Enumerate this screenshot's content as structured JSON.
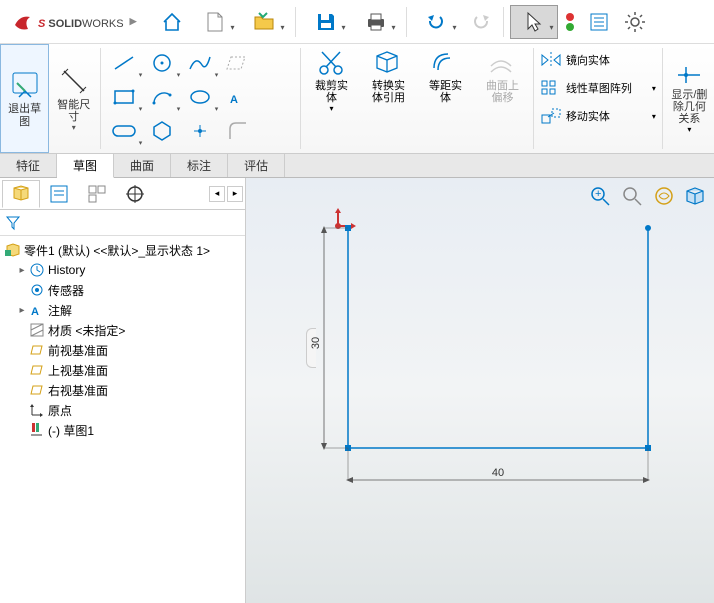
{
  "app_name_1": "SOLID",
  "app_name_2": "WORKS",
  "ribbon": {
    "exit_sketch": "退出草\n图",
    "smart_dim": "智能尺\n寸",
    "trim": "裁剪实\n体",
    "convert": "转换实\n体引用",
    "offset": "等距实\n体",
    "surface_offset": "曲面上\n偏移",
    "mirror": "镜向实体",
    "pattern": "线性草图阵列",
    "move": "移动实体",
    "display": "显示/删\n除几何\n关系"
  },
  "tabs": {
    "features": "特征",
    "sketch": "草图",
    "surfaces": "曲面",
    "annotate": "标注",
    "evaluate": "评估"
  },
  "tree": {
    "root": "零件1 (默认) <<默认>_显示状态 1>",
    "history": "History",
    "sensors": "传感器",
    "annotations": "注解",
    "material": "材质 <未指定>",
    "front": "前视基准面",
    "top": "上视基准面",
    "right": "右视基准面",
    "origin": "原点",
    "sketch1": "(-) 草图1"
  },
  "chart_data": {
    "type": "sketch",
    "dim_vertical": "30",
    "dim_horizontal": "40",
    "lines": [
      {
        "from": [
          0,
          0
        ],
        "to": [
          0,
          30
        ]
      },
      {
        "from": [
          0,
          0
        ],
        "to": [
          40,
          0
        ]
      },
      {
        "from": [
          40,
          0
        ],
        "to": [
          40,
          30
        ]
      }
    ]
  }
}
